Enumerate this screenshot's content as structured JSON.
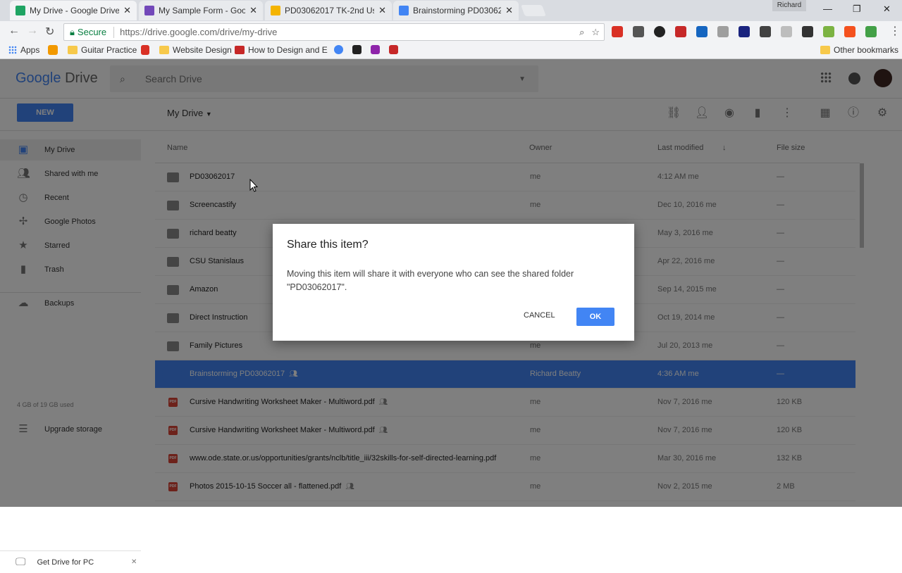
{
  "browser": {
    "tabs": [
      {
        "title": "My Drive - Google Drive",
        "color": "#1fa463"
      },
      {
        "title": "My Sample Form - Goog",
        "color": "#7248b9"
      },
      {
        "title": "PD03062017 TK-2nd Usi",
        "color": "#f4b400"
      },
      {
        "title": "Brainstorming PD030620",
        "color": "#4285f4"
      }
    ],
    "close_glyph": "✕",
    "user": "Richard",
    "secure_label": "Secure",
    "url_main": "https://drive.google.com",
    "url_path": "/drive/my-drive",
    "bookmarks": [
      "Apps",
      "Guitar Practice",
      "Website Design",
      "How to Design and E",
      "Other bookmarks"
    ]
  },
  "drive": {
    "logo_google": "Google",
    "logo_drive": "Drive",
    "search_placeholder": "Search Drive",
    "new_label": "NEW",
    "breadcrumb": "My Drive",
    "sidebar": [
      {
        "label": "My Drive",
        "icon": "drive-icon"
      },
      {
        "label": "Shared with me",
        "icon": "people-icon"
      },
      {
        "label": "Recent",
        "icon": "clock-icon"
      },
      {
        "label": "Google Photos",
        "icon": "photos-icon"
      },
      {
        "label": "Starred",
        "icon": "star-icon"
      },
      {
        "label": "Trash",
        "icon": "trash-icon"
      },
      {
        "label": "Backups",
        "icon": "cloud-icon"
      }
    ],
    "quota": "4 GB of 19 GB used",
    "upgrade": "Upgrade storage",
    "get_drive": "Get Drive for PC",
    "columns": {
      "name": "Name",
      "owner": "Owner",
      "last_modified": "Last modified",
      "file_size": "File size"
    },
    "files": [
      {
        "name": "PD03062017",
        "owner": "me",
        "modified": "4:12 AM me",
        "size": "—",
        "type": "shared-folder",
        "shared": false
      },
      {
        "name": "Screencastify",
        "owner": "me",
        "modified": "Dec 10, 2016 me",
        "size": "—",
        "type": "folder",
        "shared": false
      },
      {
        "name": "richard beatty",
        "owner": "me",
        "modified": "May 3, 2016 me",
        "size": "—",
        "type": "folder",
        "shared": false
      },
      {
        "name": "CSU Stanislaus",
        "owner": "me",
        "modified": "Apr 22, 2016 me",
        "size": "—",
        "type": "folder",
        "shared": false
      },
      {
        "name": "Amazon",
        "owner": "me",
        "modified": "Sep 14, 2015 me",
        "size": "—",
        "type": "folder",
        "shared": false
      },
      {
        "name": "Direct Instruction",
        "owner": "me",
        "modified": "Oct 19, 2014 me",
        "size": "—",
        "type": "folder",
        "shared": false
      },
      {
        "name": "Family Pictures",
        "owner": "me",
        "modified": "Jul 20, 2013 me",
        "size": "—",
        "type": "folder",
        "shared": false
      },
      {
        "name": "Brainstorming PD03062017",
        "owner": "Richard Beatty",
        "modified": "4:36 AM me",
        "size": "—",
        "type": "doc",
        "shared": true,
        "selected": true
      },
      {
        "name": "Cursive Handwriting Worksheet Maker - Multiword.pdf",
        "owner": "me",
        "modified": "Nov 7, 2016 me",
        "size": "120 KB",
        "type": "pdf",
        "shared": true
      },
      {
        "name": "Cursive Handwriting Worksheet Maker - Multiword.pdf",
        "owner": "me",
        "modified": "Nov 7, 2016 me",
        "size": "120 KB",
        "type": "pdf",
        "shared": true
      },
      {
        "name": "www.ode.state.or.us/opportunities/grants/nclb/title_iii/32skills-for-self-directed-learning.pdf",
        "owner": "me",
        "modified": "Mar 30, 2016 me",
        "size": "132 KB",
        "type": "pdf",
        "shared": false
      },
      {
        "name": "Photos 2015-10-15 Soccer all - flattened.pdf",
        "owner": "me",
        "modified": "Nov 2, 2015 me",
        "size": "2 MB",
        "type": "pdf",
        "shared": true
      }
    ],
    "pdf_label": "PDF"
  },
  "dialog": {
    "title": "Share this item?",
    "body": "Moving this item will share it with everyone who can see the shared folder \"PD03062017\".",
    "cancel": "CANCEL",
    "ok": "OK"
  }
}
